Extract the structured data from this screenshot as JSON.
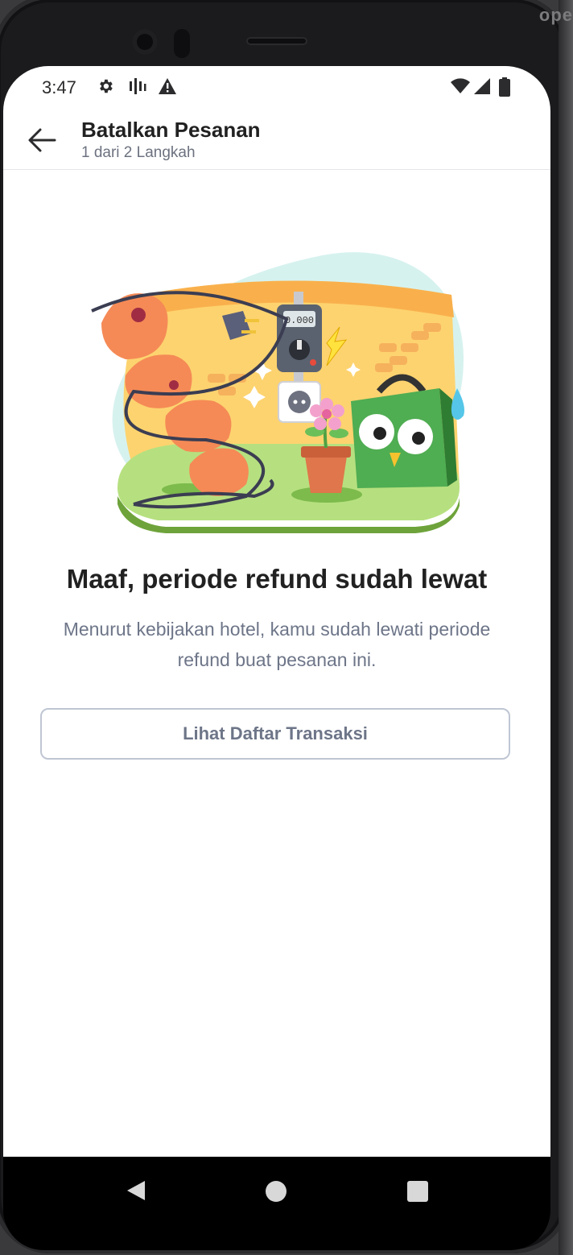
{
  "status_bar": {
    "time": "3:47",
    "icons": [
      "gear-icon",
      "signal-bars-icon",
      "warning-icon",
      "wifi-icon",
      "cellular-icon",
      "battery-icon"
    ]
  },
  "app_bar": {
    "title": "Batalkan Pesanan",
    "subtitle": "1 dari 2 Langkah",
    "back_icon": "arrow-left-icon"
  },
  "device": {
    "side_label": "ope"
  },
  "illustration": {
    "meter_display": "0.000"
  },
  "content": {
    "heading": "Maaf, periode refund sudah lewat",
    "description": "Menurut kebijakan hotel, kamu sudah lewati periode refund buat pesanan ini.",
    "button_label": "Lihat Daftar Transaksi"
  },
  "nav_bar": {
    "icons": [
      "nav-back-icon",
      "nav-home-icon",
      "nav-recents-icon"
    ]
  },
  "colors": {
    "primary_text": "#212121",
    "secondary_text": "#6d7588",
    "button_border": "#bfc6d3",
    "illustration_yellow": "#fdd36f",
    "illustration_green": "#b6e07f",
    "owl_green": "#4fad52"
  }
}
